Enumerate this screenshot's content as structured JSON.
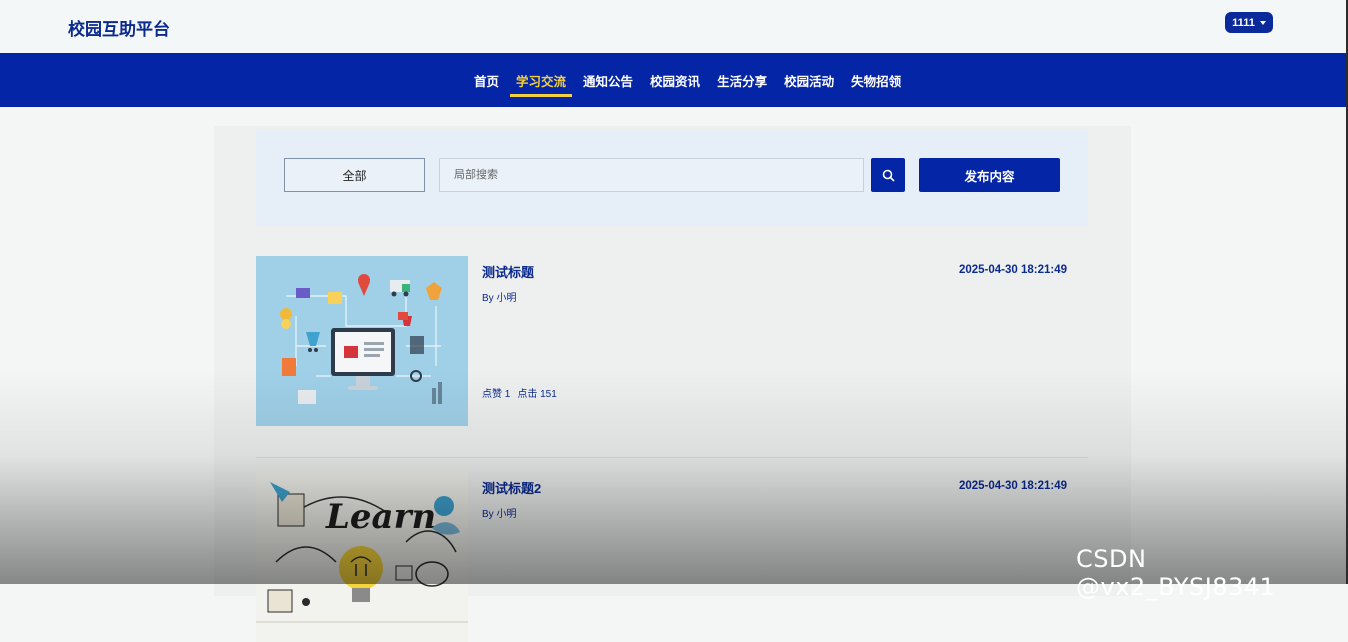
{
  "header": {
    "brand": "校园互助平台",
    "user_label": "1111"
  },
  "nav": {
    "items": [
      {
        "label": "首页",
        "active": false
      },
      {
        "label": "学习交流",
        "active": true
      },
      {
        "label": "通知公告",
        "active": false
      },
      {
        "label": "校园资讯",
        "active": false
      },
      {
        "label": "生活分享",
        "active": false
      },
      {
        "label": "校园活动",
        "active": false
      },
      {
        "label": "失物招领",
        "active": false
      }
    ]
  },
  "filter": {
    "category_label": "全部",
    "search_placeholder": "局部搜索",
    "search_icon": "search-icon",
    "publish_label": "发布内容"
  },
  "posts": [
    {
      "title": "测试标题",
      "author": "By 小明",
      "date": "2025-04-30 18:21:49",
      "likes": "点赞 1",
      "clicks": "点击 151"
    },
    {
      "title": "测试标题2",
      "author": "By 小明",
      "date": "2025-04-30 18:21:49"
    }
  ],
  "watermark": "CSDN @vx2_BYSJ8341",
  "colors": {
    "primary": "#0425a6",
    "active_nav": "#f4d03f",
    "brand_text": "#0b2a8f"
  }
}
